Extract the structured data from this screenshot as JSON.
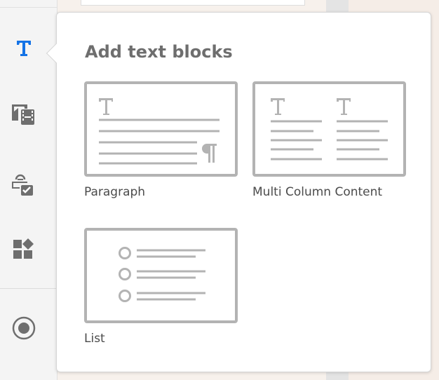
{
  "sidebar": {
    "items": [
      {
        "name": "text",
        "icon": "text-icon",
        "active": true
      },
      {
        "name": "media",
        "icon": "image-video-icon"
      },
      {
        "name": "forms",
        "icon": "form-checkbox-icon"
      },
      {
        "name": "components",
        "icon": "widgets-icon"
      },
      {
        "name": "record",
        "icon": "record-icon"
      }
    ]
  },
  "colors": {
    "accent": "#1473e6",
    "icon": "#6e6e6e",
    "thumb": "#b3b3b3"
  },
  "popover": {
    "title": "Add text blocks",
    "blocks": [
      {
        "label": "Paragraph"
      },
      {
        "label": "Multi Column Content"
      },
      {
        "label": "List"
      }
    ]
  }
}
